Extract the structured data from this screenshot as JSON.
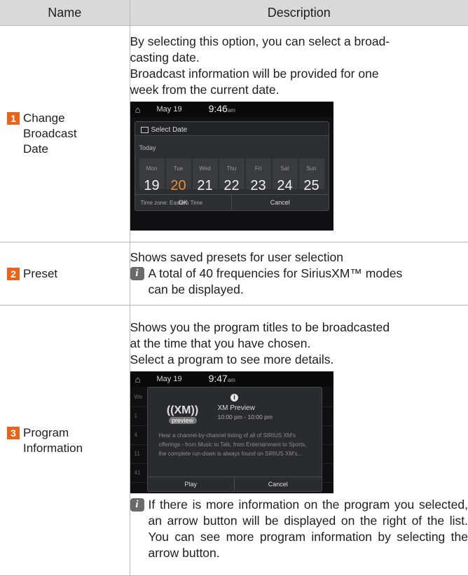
{
  "header": {
    "name": "Name",
    "description": "Description"
  },
  "rows": [
    {
      "num": "1",
      "name": "Change Broadcast Date",
      "name_lines": [
        "Change",
        "Broadcast",
        "Date"
      ],
      "desc": [
        "By selecting this option, you can select a broad-casting date.",
        "Broadcast information will be provided for one week from the current date."
      ],
      "desc_lines": [
        "By selecting this option, you can select a broad-",
        "casting date.",
        "Broadcast information will be provided for one",
        "week from the current date."
      ],
      "screen": {
        "date": "May 19",
        "time": "9:46",
        "ampm": "am",
        "dialog_title": "Select Date",
        "today": "Today",
        "days": [
          {
            "wd": "Mon",
            "dn": "19"
          },
          {
            "wd": "Tue",
            "dn": "20"
          },
          {
            "wd": "Wed",
            "dn": "21"
          },
          {
            "wd": "Thu",
            "dn": "22"
          },
          {
            "wd": "Fri",
            "dn": "23"
          },
          {
            "wd": "Sat",
            "dn": "24"
          },
          {
            "wd": "Sun",
            "dn": "25"
          }
        ],
        "selected_day": "20",
        "timezone": "Time zone: Eastern Time",
        "ok": "OK",
        "cancel": "Cancel"
      }
    },
    {
      "num": "2",
      "name": "Preset",
      "desc": [
        "Shows saved presets for user selection"
      ],
      "note": "A total of 40 frequencies for SiriusXM™ modes can be displayed.",
      "note_lines": [
        "A total of 40 frequencies for SiriusXM™ modes",
        "can be displayed."
      ]
    },
    {
      "num": "3",
      "name": "Program Information",
      "name_lines": [
        "Program",
        "Information"
      ],
      "desc": [
        "Shows you the program titles to be broadcasted at the time that you have chosen.",
        "Select a program to see more details."
      ],
      "desc_lines": [
        "Shows you the program titles to be broadcasted",
        "at the time that you have chosen.",
        "Select a program to see more details."
      ],
      "screen": {
        "date": "May 19",
        "time": "9:47",
        "ampm": "am",
        "logo": "((XM))",
        "logo_sub": "preview",
        "program_title": "XM Preview",
        "program_time": "10:00 pm - 10:00 pm",
        "program_desc": "Hear a channel-by-channel listing of all of SIRIUS XM's offerings - from Music to Talk, from Entertainment to Sports, the complete run-down is always found on SIRIUS XM's...",
        "play": "Play",
        "cancel": "Cancel",
        "bg_rows": [
          "We",
          "1",
          "4",
          "11",
          "41"
        ]
      },
      "note": "If there is more information on the program you selected, an arrow button will be displayed on the right of the list. You can see more program information by selecting the arrow button."
    }
  ],
  "colors": {
    "header_bg": "#d9d9d9",
    "number_badge": "#e8641b",
    "note_icon": "#6a6a6a",
    "selected_day": "#e8902c"
  },
  "icons": {
    "note": "info-i-icon",
    "home": "home-icon"
  }
}
